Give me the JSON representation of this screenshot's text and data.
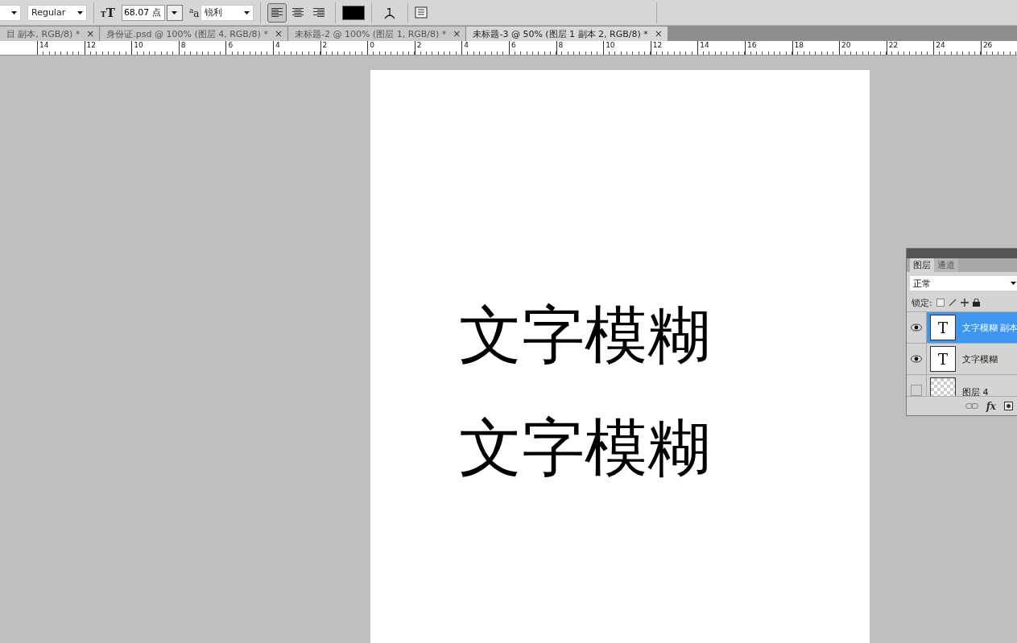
{
  "options_bar": {
    "font_style": "Regular",
    "font_size": "68.07 点",
    "antialias_icon": "a",
    "antialias_icon_sub": "a",
    "antialias": "锐利",
    "size_icon": [
      "T",
      "T"
    ],
    "alignment": [
      {
        "selected": true
      },
      {
        "selected": false
      },
      {
        "selected": false
      }
    ]
  },
  "tabs": [
    {
      "label": "目 副本, RGB/8) *",
      "selected": false
    },
    {
      "label": "身份证.psd @ 100% (图层 4, RGB/8) *",
      "selected": false
    },
    {
      "label": "未标题-2 @ 100% (图层 1, RGB/8) *",
      "selected": false
    },
    {
      "label": "未标题-3 @ 50% (图层 1 副本 2, RGB/8) *",
      "selected": true
    }
  ],
  "close_glyph": "×",
  "ruler": [
    "14",
    "12",
    "10",
    "8",
    "6",
    "4",
    "2",
    "0",
    "2",
    "4",
    "6",
    "8",
    "10",
    "12",
    "14",
    "16",
    "18",
    "20",
    "22",
    "24",
    "26"
  ],
  "canvas": {
    "texts": [
      "文字模糊",
      "文字模糊"
    ]
  },
  "layers_panel": {
    "tabs": [
      {
        "label": "图层",
        "selected": true
      },
      {
        "label": "通道",
        "selected": false
      }
    ],
    "blend_mode": "正常",
    "lock_label": "锁定:",
    "layers": [
      {
        "name": "文字模糊 副本",
        "kind": "text",
        "thumb": "T",
        "visible": true,
        "selected": true
      },
      {
        "name": "文字模糊",
        "kind": "text",
        "thumb": "T",
        "visible": true,
        "selected": false
      },
      {
        "name": "图层 4",
        "kind": "image",
        "visible": false,
        "selected": false
      }
    ],
    "fx": "fx"
  }
}
